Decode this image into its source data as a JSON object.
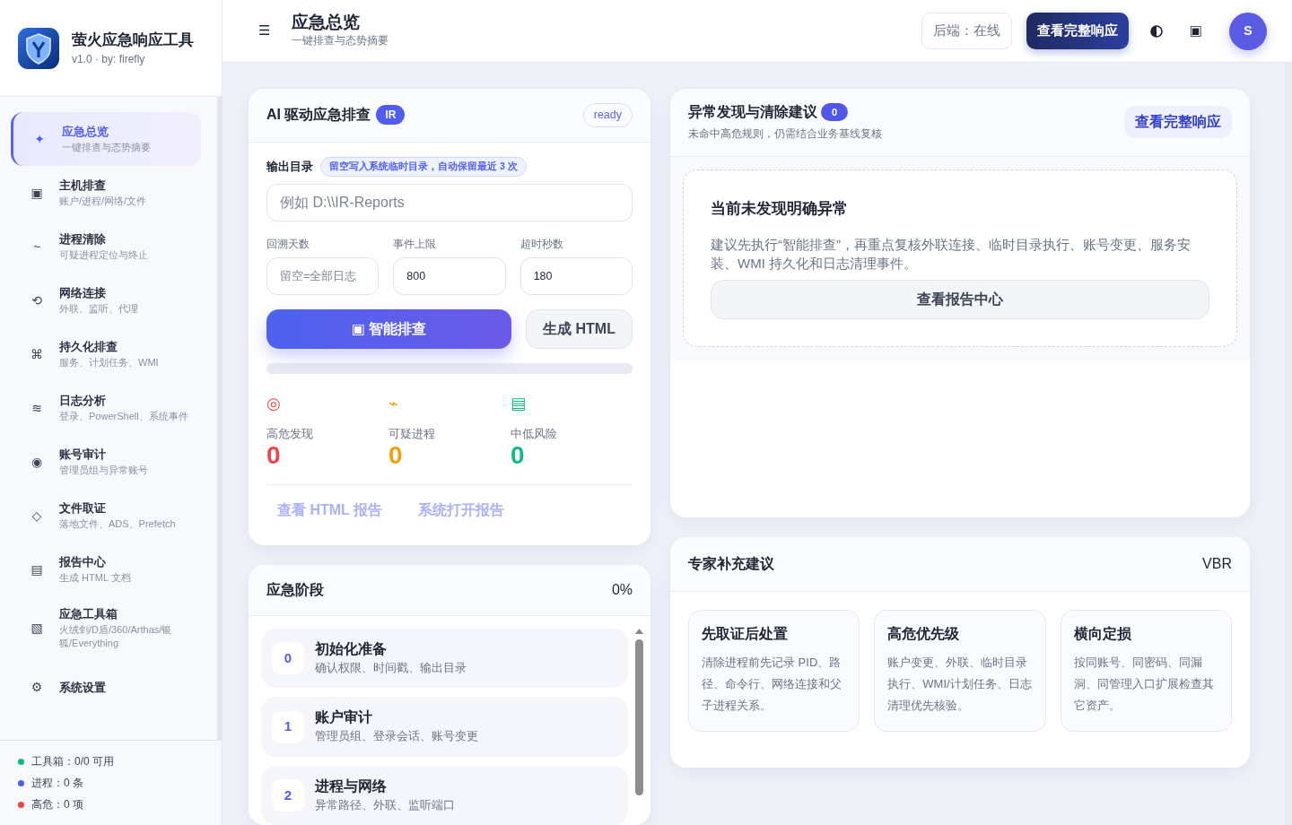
{
  "sidebar": {
    "app_title": "萤火应急响应工具",
    "app_subtitle": "v1.0 · by: firefly",
    "items": [
      {
        "glyph": "✦",
        "title": "应急总览",
        "subtitle": "一键排查与态势摘要",
        "selected": true
      },
      {
        "glyph": "▣",
        "title": "主机排查",
        "subtitle": "账户/进程/网络/文件",
        "selected": false
      },
      {
        "glyph": "~",
        "title": "进程清除",
        "subtitle": "可疑进程定位与终止",
        "selected": false
      },
      {
        "glyph": "⟲",
        "title": "网络连接",
        "subtitle": "外联、监听、代理",
        "selected": false
      },
      {
        "glyph": "⌘",
        "title": "持久化排查",
        "subtitle": "服务、计划任务、WMI",
        "selected": false
      },
      {
        "glyph": "≋",
        "title": "日志分析",
        "subtitle": "登录、PowerShell、系统事件",
        "selected": false
      },
      {
        "glyph": "◉",
        "title": "账号审计",
        "subtitle": "管理员组与异常账号",
        "selected": false
      },
      {
        "glyph": "◇",
        "title": "文件取证",
        "subtitle": "落地文件、ADS、Prefetch",
        "selected": false
      },
      {
        "glyph": "▤",
        "title": "报告中心",
        "subtitle": "生成 HTML 文档",
        "selected": false
      },
      {
        "glyph": "▧",
        "title": "应急工具箱",
        "subtitle": "火绒剑/D盾/360/Arthas/银狐/Everything",
        "selected": false
      },
      {
        "glyph": "⚙",
        "title": "系统设置",
        "selected": false
      }
    ],
    "status": [
      {
        "text": "工具箱：0/0 可用",
        "color": "#10b981"
      },
      {
        "text": "进程：0 条",
        "color": "#4f5ef0"
      },
      {
        "text": "高危：0 项",
        "color": "#ef4444"
      }
    ]
  },
  "header": {
    "menu_glyph": "☰",
    "title": "应急总览",
    "subtitle": "一键排查与态势摘要",
    "backend_status": "后端：在线",
    "primary_button": "查看完整响应",
    "window_glyph": "▣",
    "avatar": "S"
  },
  "scan_card": {
    "title": "AI 驱动应急排查",
    "badge": "IR",
    "status": "ready",
    "output_label": "输出目录",
    "output_hint": "留空写入系统临时目录，自动保留最近 3 次",
    "output_field": {
      "placeholder": "例如 D:\\\\IR-Reports"
    },
    "params": [
      {
        "label": "回溯天数",
        "placeholder": "留空=全部日志"
      },
      {
        "label": "事件上限",
        "value": "800"
      },
      {
        "label": "超时秒数",
        "value": "180"
      }
    ],
    "scan_button": {
      "glyph": "▣",
      "label": "智能排查"
    },
    "html_button": "生成 HTML",
    "progress": {
      "level": 0
    },
    "stats": [
      {
        "glyph": "◎",
        "label": "高危发现",
        "value": "0",
        "color": "#ef4444"
      },
      {
        "glyph": "⌁",
        "label": "可疑进程",
        "value": "0",
        "color": "#f59e0b"
      },
      {
        "glyph": "▤",
        "label": "中低风险",
        "value": "0",
        "color": "#10b981"
      }
    ],
    "links": [
      {
        "label": "查看 HTML 报告",
        "disabled": true
      },
      {
        "label": "系统打开报告",
        "disabled": true
      }
    ]
  },
  "stages_card": {
    "title": "应急阶段",
    "percent": "0%",
    "stages": [
      {
        "number": "0",
        "title": "初始化准备",
        "subtitle": "确认权限、时间戳、输出目录"
      },
      {
        "number": "1",
        "title": "账户审计",
        "subtitle": "管理员组、登录会话、账号变更"
      },
      {
        "number": "2",
        "title": "进程与网络",
        "subtitle": "异常路径、外联、监听端口"
      }
    ]
  },
  "findings_card": {
    "title": "异常发现与清除建议",
    "count": "0",
    "subtitle": "未命中高危规则，仍需结合业务基线复核",
    "action": "查看完整响应",
    "empty": {
      "title": "当前未发现明确异常",
      "text": "建议先执行“智能排查”，再重点复核外联连接、临时目录执行、账号变更、服务安装、WMI 持久化和日志清理事件。",
      "button": "查看报告中心"
    }
  },
  "expert_card": {
    "title": "专家补充建议",
    "tag": "VBR",
    "tips": [
      {
        "title": "先取证后处置",
        "text": "清除进程前先记录 PID、路径、命令行、网络连接和父子进程关系。"
      },
      {
        "title": "高危优先级",
        "text": "账户变更、外联、临时目录执行、WMI/计划任务、日志清理优先核验。"
      },
      {
        "title": "横向定损",
        "text": "按同账号、同密码、同漏洞、同管理入口扩展检查其它资产。"
      }
    ]
  }
}
